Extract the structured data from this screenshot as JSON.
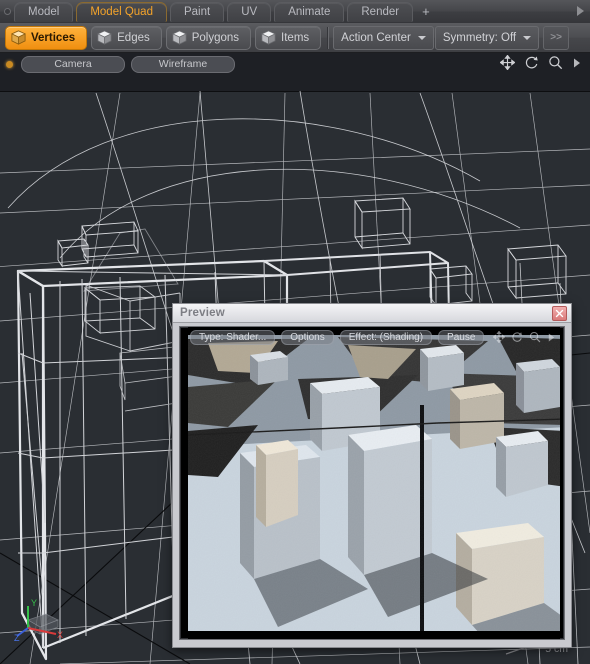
{
  "app": {
    "tabs": [
      {
        "label": "Model",
        "active": false
      },
      {
        "label": "Model Quad",
        "active": true
      },
      {
        "label": "Paint",
        "active": false
      },
      {
        "label": "UV",
        "active": false
      },
      {
        "label": "Animate",
        "active": false
      },
      {
        "label": "Render",
        "active": false
      }
    ],
    "add_tab_label": "+",
    "overflow_icon": "triangle-right-icon"
  },
  "mode_toolbar": {
    "buttons": [
      {
        "label": "Vertices",
        "active": true,
        "icon": "cube-icon"
      },
      {
        "label": "Edges",
        "active": false,
        "icon": "cube-icon"
      },
      {
        "label": "Polygons",
        "active": false,
        "icon": "cube-icon"
      },
      {
        "label": "Items",
        "active": false,
        "icon": "cube-icon"
      }
    ],
    "action_center": "Action Center",
    "symmetry": "Symmetry: Off",
    "more_label": ">>"
  },
  "viewport": {
    "indicator_icon": "active-dot-icon",
    "buttons": [
      "Camera",
      "Wireframe"
    ],
    "tools": [
      "move-icon",
      "rotate-icon",
      "zoom-icon",
      "triangle-right-icon"
    ],
    "axis_labels": {
      "x": "X",
      "y": "Y",
      "z": "Z"
    },
    "scale_label": "5 cm"
  },
  "preview_window": {
    "title": "Preview",
    "close_icon": "close-icon",
    "toolbar": [
      "Type: Shader...",
      "Options",
      "Effect: (Shading)",
      "Pause"
    ],
    "tools": [
      "move-icon",
      "rotate-icon",
      "zoom-icon",
      "triangle-right-icon"
    ]
  },
  "colors": {
    "accent": "#f3a32a",
    "chrome": "#4a4b4f",
    "viewport_sky": "#1e2025",
    "viewport_ground": "#2a2e33",
    "wireframe": "#d6d8dc",
    "close_red": "#d97a7a"
  }
}
